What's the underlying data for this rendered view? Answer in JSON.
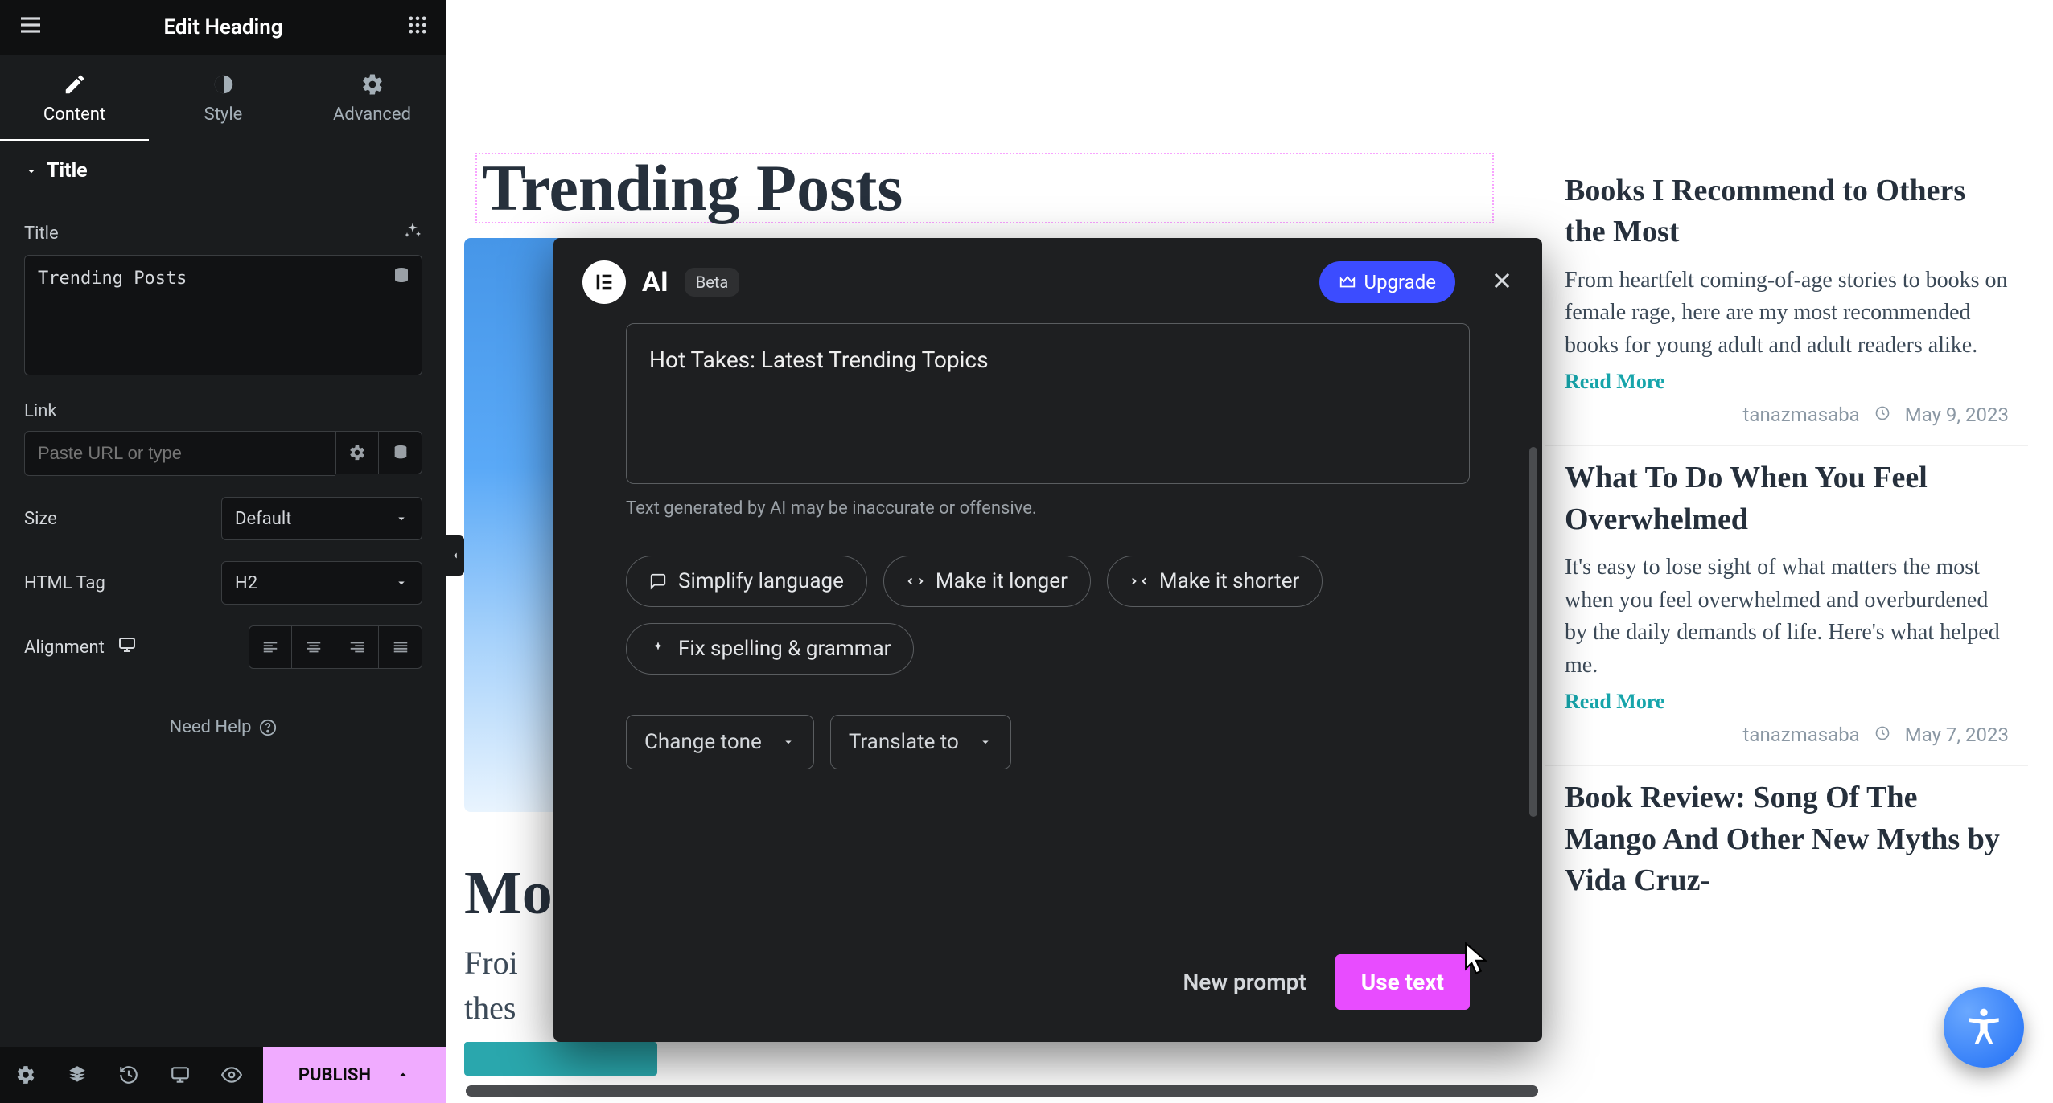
{
  "panel": {
    "title": "Edit Heading",
    "tabs": {
      "content": "Content",
      "style": "Style",
      "advanced": "Advanced"
    },
    "section_title": "Title",
    "title_label": "Title",
    "title_value": "Trending Posts",
    "link_label": "Link",
    "link_placeholder": "Paste URL or type",
    "size_label": "Size",
    "size_value": "Default",
    "tag_label": "HTML Tag",
    "tag_value": "H2",
    "align_label": "Alignment",
    "need_help": "Need Help"
  },
  "footer": {
    "publish": "PUBLISH"
  },
  "canvas": {
    "heading": "Trending Posts",
    "more_heading": "Mo",
    "line1": "Froi",
    "line2": "thes"
  },
  "sidebar": {
    "posts": [
      {
        "title": "Books I Recommend to Others the Most",
        "excerpt": "From heartfelt coming-of-age stories to books on female rage, here are my most recommended books for young adult and adult readers alike.",
        "read_more": "Read More",
        "author": "tanazmasaba",
        "date": "May 9, 2023"
      },
      {
        "title": "What To Do When You Feel Overwhelmed",
        "excerpt": "It's easy to lose sight of what matters the most when you feel overwhelmed and overburdened by the daily demands of life. Here's what helped me.",
        "read_more": "Read More",
        "author": "tanazmasaba",
        "date": "May 7, 2023"
      },
      {
        "title": "Book Review: Song Of The Mango And Other New Myths by Vida Cruz-",
        "excerpt": "",
        "read_more": "",
        "author": "",
        "date": ""
      }
    ]
  },
  "ai": {
    "title": "AI",
    "beta": "Beta",
    "upgrade": "Upgrade",
    "textbox": "Hot Takes: Latest Trending Topics",
    "hint": "Text generated by AI may be inaccurate or offensive.",
    "chips": {
      "simplify": "Simplify language",
      "longer": "Make it longer",
      "shorter": "Make it shorter",
      "fix": "Fix spelling & grammar"
    },
    "tone": "Change tone",
    "translate": "Translate to",
    "new_prompt": "New prompt",
    "use_text": "Use text"
  }
}
